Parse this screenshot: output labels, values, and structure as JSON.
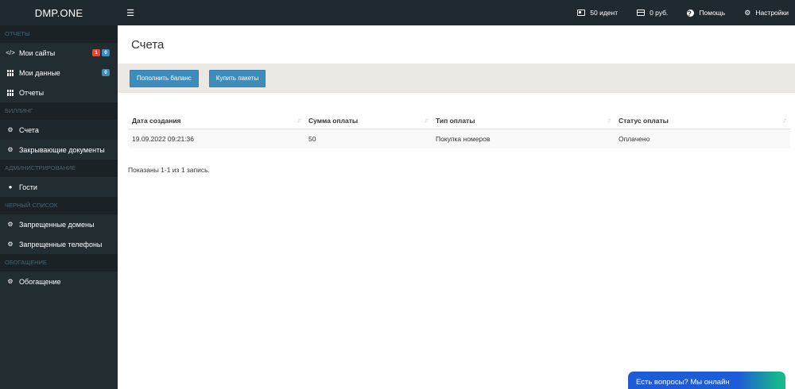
{
  "brand": "DMP.ONE",
  "topnav": {
    "idents": "50 идент",
    "balance": "0 руб.",
    "help": "Помощь",
    "settings": "Настройки"
  },
  "sidebar": {
    "sections": [
      {
        "title": "ОТЧЕТЫ"
      },
      {
        "title": "БИЛЛИНГ"
      },
      {
        "title": "АДМИНИСТРИРОВАНИЕ"
      },
      {
        "title": "ЧЕРНЫЙ СПИСОК"
      },
      {
        "title": "ОБОГАЩЕНИЕ"
      }
    ],
    "items": [
      {
        "label": "Мои сайты",
        "icon": "code-icon",
        "badges": [
          "1",
          "0"
        ]
      },
      {
        "label": "Мои данные",
        "icon": "table-icon",
        "badges": [
          "0"
        ]
      },
      {
        "label": "Отчеты",
        "icon": "table-icon"
      },
      {
        "label": "Счета",
        "icon": "gear-icon"
      },
      {
        "label": "Закрывающие документы",
        "icon": "gear-icon"
      },
      {
        "label": "Гости",
        "icon": "users-icon"
      },
      {
        "label": "Запрещенные домены",
        "icon": "gear-icon"
      },
      {
        "label": "Запрещенные телефоны",
        "icon": "gear-icon"
      },
      {
        "label": "Обогащение",
        "icon": "gear-icon"
      }
    ]
  },
  "page": {
    "title": "Счета",
    "buttons": {
      "topup": "Пополнить баланс",
      "buy": "Купить пакеты"
    }
  },
  "table": {
    "columns": [
      "Дата создания",
      "Сумма оплаты",
      "Тип оплаты",
      "Статус оплаты"
    ],
    "rows": [
      [
        "19.09.2022 09:21:36",
        "50",
        "Покупка номеров",
        "Оплачено"
      ]
    ],
    "info": "Показаны 1-1 из 1 запись."
  },
  "chat": {
    "label": "Есть вопросы? Мы онлайн"
  },
  "colors": {
    "topbar": "#1f2a30",
    "sidebar": "#222d32",
    "accent": "#3c8dbc",
    "badge_red": "#dd4b39"
  }
}
